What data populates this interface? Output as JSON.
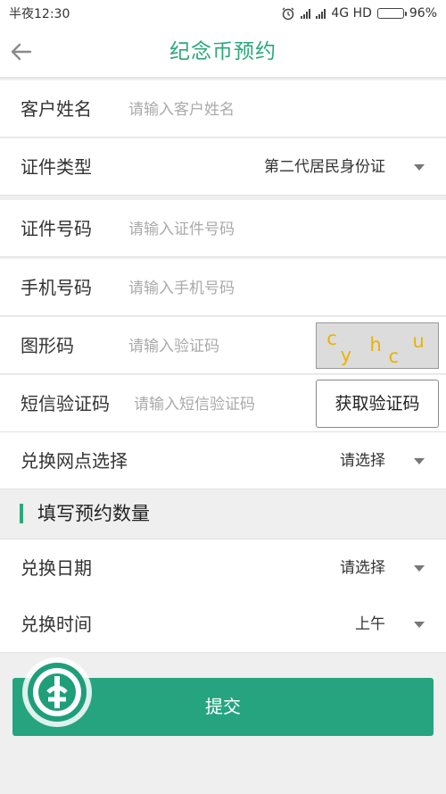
{
  "status_bar": {
    "time": "半夜12:30",
    "network": "4G HD",
    "battery": "96%",
    "battery_level": 0.96,
    "icons": [
      "alarm-icon",
      "signal-icon",
      "signal-icon",
      "battery-icon"
    ]
  },
  "header": {
    "title": "纪念币预约",
    "back_icon": "arrow-left-icon"
  },
  "form": {
    "name": {
      "label": "客户姓名",
      "placeholder": "请输入客户姓名",
      "value": ""
    },
    "id_type": {
      "label": "证件类型",
      "value": "第二代居民身份证"
    },
    "id_number": {
      "label": "证件号码",
      "placeholder": "请输入证件号码",
      "value": ""
    },
    "phone": {
      "label": "手机号码",
      "placeholder": "请输入手机号码",
      "value": ""
    },
    "captcha": {
      "label": "图形码",
      "placeholder": "请输入验证码",
      "value": "",
      "image_text": "cyhcu"
    },
    "sms": {
      "label": "短信验证码",
      "placeholder": "请输入短信验证码",
      "value": "",
      "button": "获取验证码"
    },
    "branch": {
      "label": "兑换网点选择",
      "value": "请选择"
    }
  },
  "section": {
    "title": "填写预约数量"
  },
  "form2": {
    "date": {
      "label": "兑换日期",
      "value": "请选择"
    },
    "time": {
      "label": "兑换时间",
      "value": "上午"
    }
  },
  "submit_label": "提交",
  "colors": {
    "accent": "#2ba87a",
    "button": "#26a480",
    "captcha_text": "#e8b400"
  }
}
